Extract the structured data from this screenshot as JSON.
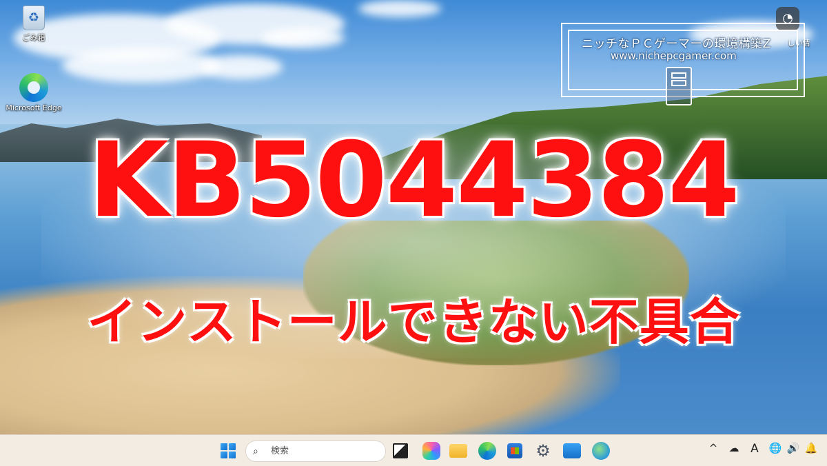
{
  "desktop": {
    "icons": [
      {
        "label": "ごみ箱",
        "icon": "recycle-bin-icon"
      },
      {
        "label": "Microsoft Edge",
        "icon": "edge-icon"
      }
    ],
    "widget_text": "しい情"
  },
  "watermark": {
    "title": "ニッチなＰＣゲーマーの環境構築Z",
    "url": "www.nichepcgamer.com"
  },
  "headline": {
    "title": "KB5044384",
    "subtitle": "インストールできない不具合"
  },
  "taskbar": {
    "search_placeholder": "検索",
    "pinned": [
      "start-icon",
      "task-view-icon",
      "copilot-icon",
      "file-explorer-icon",
      "edge-icon",
      "store-icon",
      "settings-icon",
      "photos-icon",
      "globe-icon"
    ],
    "tray": {
      "ime": "A",
      "chevron": "^"
    }
  },
  "colors": {
    "headline": "#ff1010",
    "taskbar_bg": "#f3ece3"
  }
}
